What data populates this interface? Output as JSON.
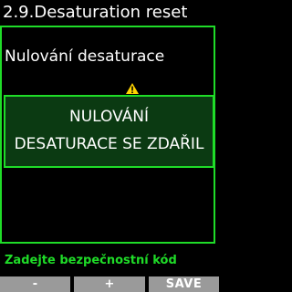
{
  "header": {
    "title": "2.9.Desaturation reset"
  },
  "main": {
    "subtitle": "Nulování desaturace",
    "warning_icon": "warning-triangle-icon"
  },
  "popup": {
    "line1": "NULOVÁNÍ",
    "line2": "DESATURACE SE ZDAŘIL"
  },
  "footer": {
    "prompt": "Zadejte bezpečnostní kód",
    "softkeys": [
      "-",
      "+",
      "SAVE"
    ]
  },
  "colors": {
    "accent": "#1fdc28",
    "popup_bg": "#0b3a12",
    "softkey_bg": "#9a9a9a",
    "warning": "#ffd400"
  }
}
